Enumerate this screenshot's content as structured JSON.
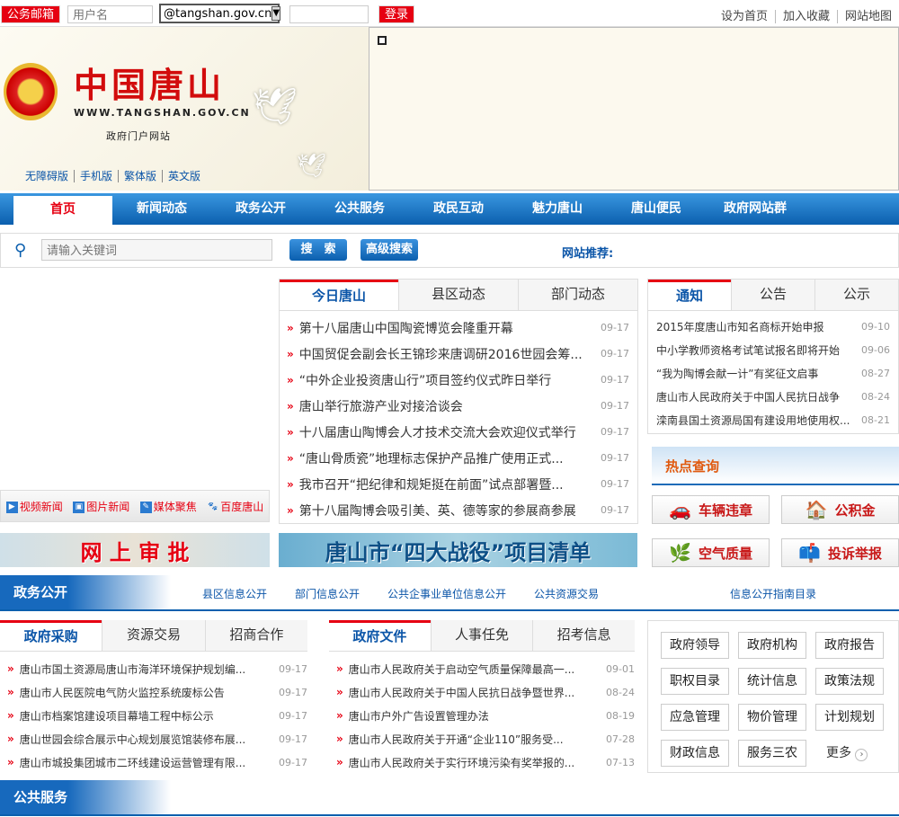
{
  "topbar": {
    "mail_label": "公务邮箱",
    "username_placeholder": "用户名",
    "domain": "@tangshan.gov.cn",
    "login": "登录",
    "links": [
      "设为首页",
      "加入收藏",
      "网站地图"
    ]
  },
  "header": {
    "logo_cn": "中国唐山",
    "logo_url": "WWW.TANGSHAN.GOV.CN",
    "logo_sub": "政府门户网站",
    "versions": [
      "无障碍版",
      "手机版",
      "繁体版",
      "英文版"
    ]
  },
  "nav": [
    "首页",
    "新闻动态",
    "政务公开",
    "公共服务",
    "政民互动",
    "魅力唐山",
    "唐山便民",
    "政府网站群"
  ],
  "search": {
    "placeholder": "请输入关键词",
    "search_btn": "搜　索",
    "advanced_btn": "高级搜索",
    "recommend": "网站推荐:"
  },
  "quick_links": [
    "视频新闻",
    "图片新闻",
    "媒体聚焦",
    "百度唐山"
  ],
  "news": {
    "tabs": [
      "今日唐山",
      "县区动态",
      "部门动态"
    ],
    "items": [
      {
        "t": "第十八届唐山中国陶瓷博览会隆重开幕",
        "d": "09-17"
      },
      {
        "t": "中国贸促会副会长王锦珍来唐调研2016世园会筹...",
        "d": "09-17"
      },
      {
        "t": "“中外企业投资唐山行”项目签约仪式昨日举行",
        "d": "09-17"
      },
      {
        "t": "唐山举行旅游产业对接洽谈会",
        "d": "09-17"
      },
      {
        "t": "十八届唐山陶博会人才技术交流大会欢迎仪式举行",
        "d": "09-17"
      },
      {
        "t": "“唐山骨质瓷”地理标志保护产品推广使用正式...",
        "d": "09-17"
      },
      {
        "t": "我市召开“把纪律和规矩挺在前面”试点部署暨...",
        "d": "09-17"
      },
      {
        "t": "第十八届陶博会吸引美、英、德等家的参展商参展",
        "d": "09-17"
      }
    ]
  },
  "notice": {
    "tabs": [
      "通知",
      "公告",
      "公示"
    ],
    "items": [
      {
        "t": "2015年度唐山市知名商标开始申报",
        "d": "09-10"
      },
      {
        "t": "中小学教师资格考试笔试报名即将开始",
        "d": "09-06"
      },
      {
        "t": "“我为陶博会献一计”有奖征文启事",
        "d": "08-27"
      },
      {
        "t": "唐山市人民政府关于中国人民抗日战争",
        "d": "08-24"
      },
      {
        "t": "滦南县国土资源局国有建设用地使用权...",
        "d": "08-21"
      }
    ]
  },
  "hot": {
    "title": "热点查询",
    "buttons": [
      "车辆违章",
      "公积金",
      "空气质量",
      "投诉举报"
    ]
  },
  "banners": [
    "网 上 审 批",
    "唐山市“四大战役”项目清单"
  ],
  "gov_open": {
    "title": "政务公开",
    "links": [
      "县区信息公开",
      "部门信息公开",
      "公共企事业单位信息公开",
      "公共资源交易",
      "信息公开指南目录"
    ]
  },
  "procure": {
    "tabs": [
      "政府采购",
      "资源交易",
      "招商合作"
    ],
    "items": [
      {
        "t": "唐山市国土资源局唐山市海洋环境保护规划编...",
        "d": "09-17"
      },
      {
        "t": "唐山市人民医院电气防火监控系统废标公告",
        "d": "09-17"
      },
      {
        "t": "唐山市档案馆建设项目幕墙工程中标公示",
        "d": "09-17"
      },
      {
        "t": "唐山世园会综合展示中心规划展览馆装修布展...",
        "d": "09-17"
      },
      {
        "t": "唐山市城投集团城市二环线建设运营管理有限...",
        "d": "09-17"
      }
    ]
  },
  "docs": {
    "tabs": [
      "政府文件",
      "人事任免",
      "招考信息"
    ],
    "items": [
      {
        "t": "唐山市人民政府关于启动空气质量保障最高一...",
        "d": "09-01"
      },
      {
        "t": "唐山市人民政府关于中国人民抗日战争暨世界...",
        "d": "08-24"
      },
      {
        "t": "唐山市户外广告设置管理办法",
        "d": "08-19"
      },
      {
        "t": "唐山市人民政府关于开通“企业110”服务受...",
        "d": "07-28"
      },
      {
        "t": "唐山市人民政府关于实行环境污染有奖举报的...",
        "d": "07-13"
      }
    ]
  },
  "gov_grid": [
    "政府领导",
    "政府机构",
    "政府报告",
    "职权目录",
    "统计信息",
    "政策法规",
    "应急管理",
    "物价管理",
    "计划规划",
    "财政信息",
    "服务三农"
  ],
  "more": "更多",
  "public_service": {
    "title": "公共服务"
  }
}
